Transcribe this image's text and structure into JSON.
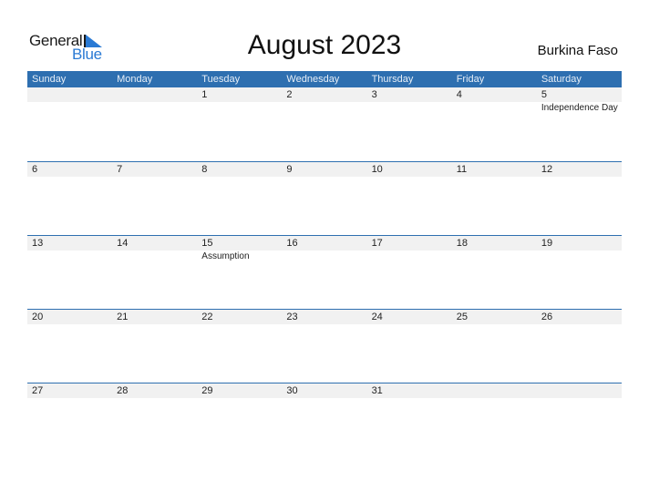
{
  "logo": {
    "word1": "General",
    "word2": "Blue"
  },
  "header": {
    "title": "August 2023",
    "country": "Burkina Faso"
  },
  "colors": {
    "accent": "#2e6fb0",
    "date_strip": "#f1f1f1",
    "logo_blue": "#2a7ad4"
  },
  "weekdays": [
    "Sunday",
    "Monday",
    "Tuesday",
    "Wednesday",
    "Thursday",
    "Friday",
    "Saturday"
  ],
  "weeks": [
    {
      "days": [
        "",
        "",
        "1",
        "2",
        "3",
        "4",
        "5"
      ],
      "events": [
        "",
        "",
        "",
        "",
        "",
        "",
        "Independence Day"
      ]
    },
    {
      "days": [
        "6",
        "7",
        "8",
        "9",
        "10",
        "11",
        "12"
      ],
      "events": [
        "",
        "",
        "",
        "",
        "",
        "",
        ""
      ]
    },
    {
      "days": [
        "13",
        "14",
        "15",
        "16",
        "17",
        "18",
        "19"
      ],
      "events": [
        "",
        "",
        "Assumption",
        "",
        "",
        "",
        ""
      ]
    },
    {
      "days": [
        "20",
        "21",
        "22",
        "23",
        "24",
        "25",
        "26"
      ],
      "events": [
        "",
        "",
        "",
        "",
        "",
        "",
        ""
      ]
    },
    {
      "days": [
        "27",
        "28",
        "29",
        "30",
        "31",
        "",
        ""
      ],
      "events": [
        "",
        "",
        "",
        "",
        "",
        "",
        ""
      ]
    }
  ]
}
